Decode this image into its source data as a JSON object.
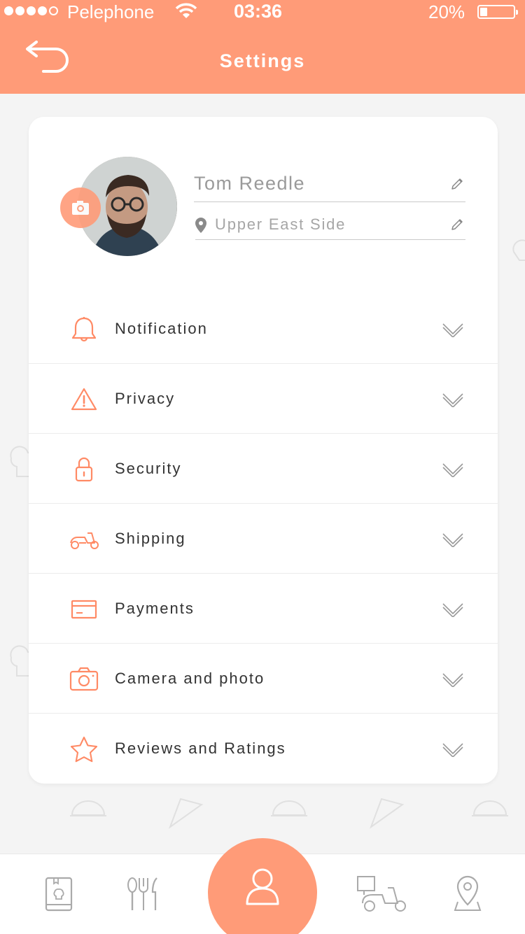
{
  "status_bar": {
    "carrier": "Pelephone",
    "time": "03:36",
    "battery": "20%"
  },
  "header": {
    "title": "Settings"
  },
  "profile": {
    "name": "Tom Reedle",
    "location": "Upper East Side"
  },
  "menu": {
    "items": [
      {
        "label": "Notification",
        "icon": "bell-icon"
      },
      {
        "label": "Privacy",
        "icon": "warning-icon"
      },
      {
        "label": "Security",
        "icon": "lock-icon"
      },
      {
        "label": "Shipping",
        "icon": "scooter-icon"
      },
      {
        "label": "Payments",
        "icon": "credit-card-icon"
      },
      {
        "label": "Camera and photo",
        "icon": "camera-icon"
      },
      {
        "label": "Reviews and Ratings",
        "icon": "star-icon"
      }
    ]
  },
  "bottom_nav": {
    "items": [
      "menu-book-icon",
      "cutlery-icon",
      "profile-icon",
      "delivery-scooter-icon",
      "map-pin-icon"
    ],
    "active": "profile-icon"
  },
  "colors": {
    "accent": "#ff9b78",
    "background": "#f4f4f4",
    "text": "#333333",
    "muted": "#9a9a9a"
  }
}
